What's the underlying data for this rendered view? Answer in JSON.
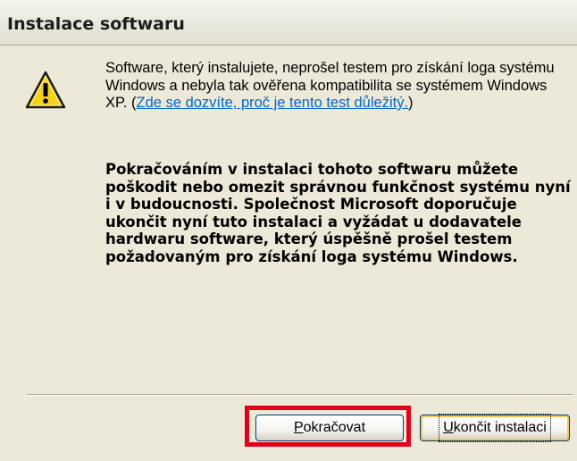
{
  "window": {
    "title": "Instalace softwaru"
  },
  "icon": {
    "name": "warning-icon",
    "color_fill": "#f7d21c",
    "color_outline": "#1e1e1e"
  },
  "message": {
    "text_before_link": "Software, který instalujete, neprošel testem pro získání loga systému Windows a nebyla tak ověřena kompatibilita se systémem Windows XP. (",
    "link_text": "Zde se dozvíte, proč je tento test důležitý.",
    "text_after_link": ")",
    "warning_bold": "Pokračováním v instalaci tohoto softwaru můžete poškodit nebo omezit správnou funkčnost systému nyní i v budoucnosti. Společnost Microsoft doporučuje ukončit nyní tuto instalaci a vyžádat u dodavatele hardwaru software, který úspěšně prošel testem požadovaným pro získání loga systému Windows."
  },
  "buttons": {
    "continue": {
      "accel": "P",
      "rest": "okračovat"
    },
    "exit": {
      "accel": "U",
      "rest": "končit instalaci"
    }
  },
  "colors": {
    "highlight": "#e3001b",
    "link": "#0066cc",
    "dialog_bg": "#ece9d8"
  }
}
